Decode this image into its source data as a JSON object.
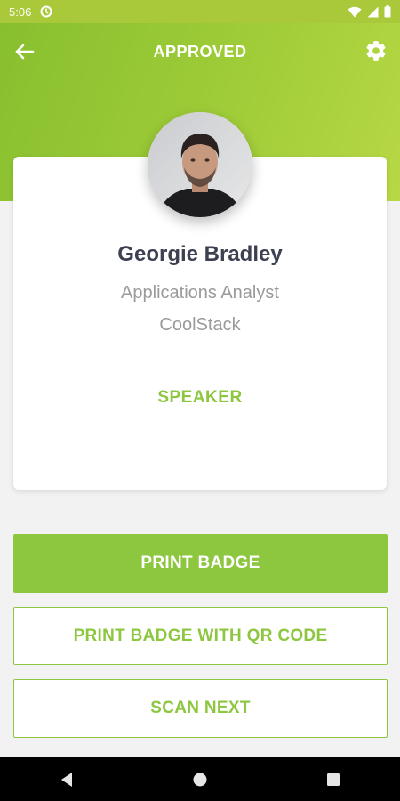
{
  "status_bar": {
    "time": "5:06",
    "icons": [
      "data-saver-icon",
      "wifi-icon",
      "signal-icon",
      "battery-icon"
    ]
  },
  "header": {
    "title": "APPROVED",
    "back_icon": "back-arrow-icon",
    "settings_icon": "gear-icon"
  },
  "profile": {
    "name": "Georgie Bradley",
    "job_title": "Applications Analyst",
    "company": "CoolStack",
    "role": "SPEAKER"
  },
  "actions": {
    "print_badge": "PRINT BADGE",
    "print_badge_qr": "PRINT BADGE WITH QR CODE",
    "scan_next": "SCAN NEXT"
  },
  "colors": {
    "accent": "#8dc63f",
    "header_gradient_start": "#88bf2f",
    "header_gradient_end": "#b7d844",
    "name_text": "#3c4050",
    "secondary_text": "#9a9a9a"
  },
  "navigation": {
    "items": [
      "back-triangle-icon",
      "home-circle-icon",
      "recents-square-icon"
    ]
  }
}
